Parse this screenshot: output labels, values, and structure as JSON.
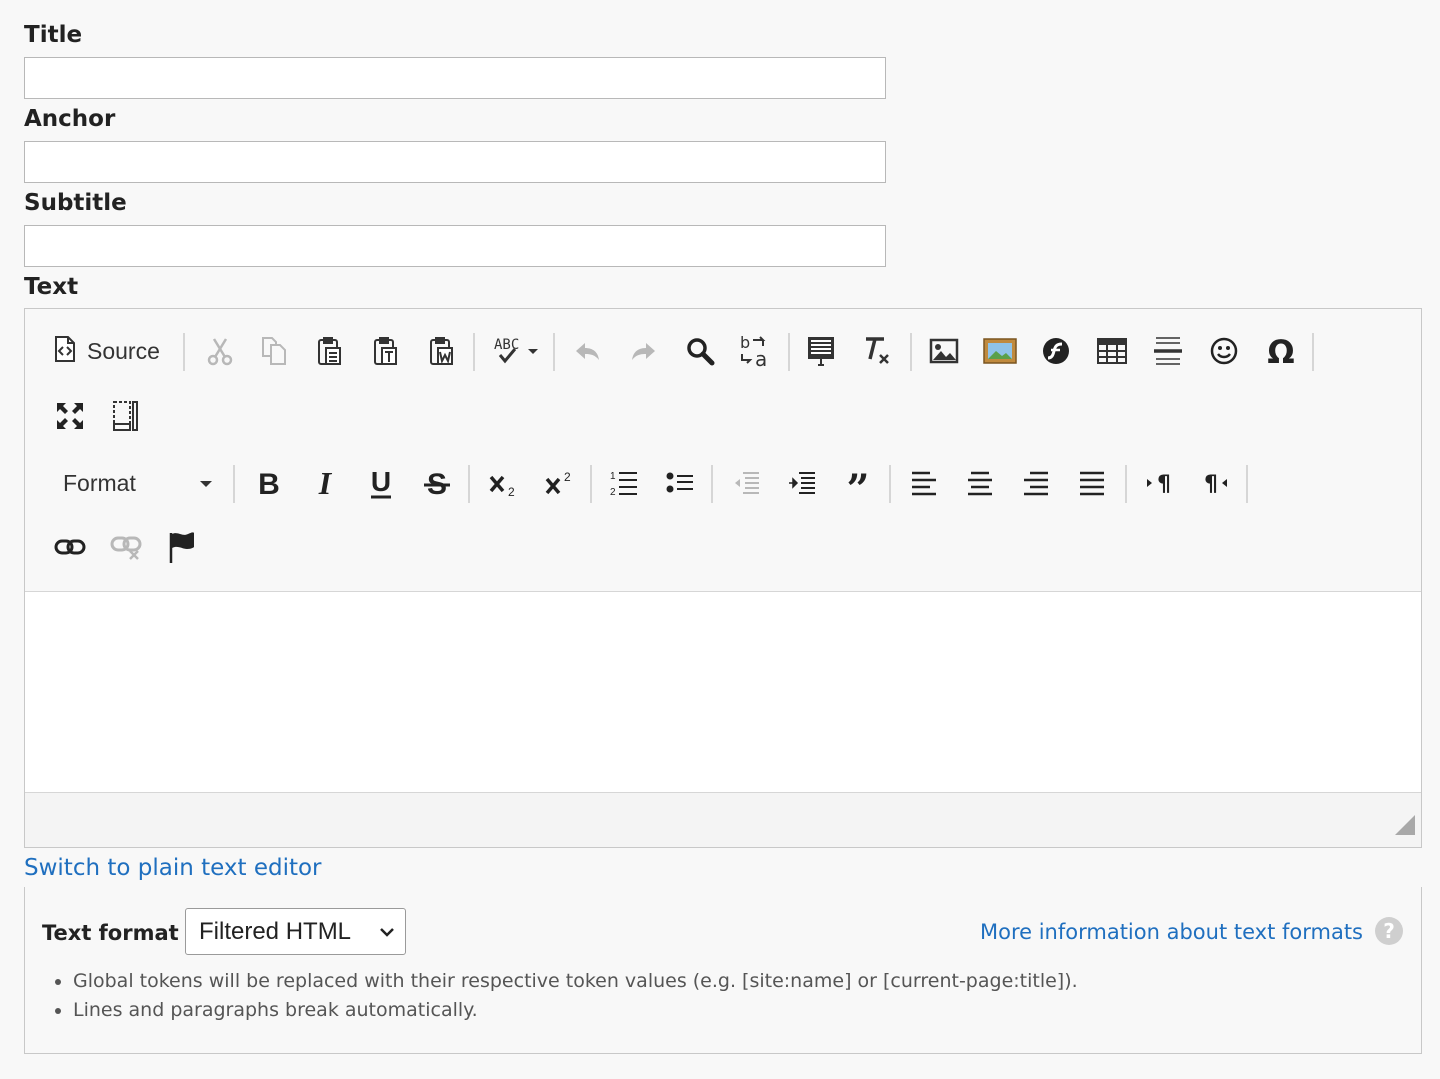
{
  "form": {
    "title_label": "Title",
    "title_value": "",
    "anchor_label": "Anchor",
    "anchor_value": "",
    "subtitle_label": "Subtitle",
    "subtitle_value": "",
    "text_label": "Text"
  },
  "editor": {
    "source_label": "Source",
    "format_label": "Format",
    "content": ""
  },
  "switch_link": "Switch to plain text editor",
  "text_format": {
    "label": "Text format",
    "selected": "Filtered HTML",
    "more_info_link": "More information about text formats",
    "help_glyph": "?",
    "tips": [
      "Global tokens will be replaced with their respective token values (e.g. [site:name] or [current-page:title]).",
      "Lines and paragraphs break automatically."
    ]
  },
  "icons": {
    "toolbar_row1": [
      "source-icon",
      "cut-icon",
      "copy-icon",
      "paste-icon",
      "paste-text-icon",
      "paste-word-icon",
      "spellcheck-icon",
      "undo-icon",
      "redo-icon",
      "find-icon",
      "replace-icon",
      "select-all-icon",
      "remove-format-icon",
      "image-icon",
      "image-alt-icon",
      "flash-icon",
      "table-icon",
      "horizontal-rule-icon",
      "smiley-icon",
      "special-char-icon"
    ],
    "toolbar_row2": [
      "maximize-icon",
      "show-blocks-icon"
    ],
    "toolbar_row3": [
      "bold-icon",
      "italic-icon",
      "underline-icon",
      "strike-icon",
      "subscript-icon",
      "superscript-icon",
      "numbered-list-icon",
      "bulleted-list-icon",
      "outdent-icon",
      "indent-icon",
      "blockquote-icon",
      "align-left-icon",
      "align-center-icon",
      "align-right-icon",
      "justify-icon",
      "ltr-icon",
      "rtl-icon"
    ],
    "toolbar_row4": [
      "link-icon",
      "unlink-icon",
      "anchor-flag-icon"
    ]
  },
  "colors": {
    "link": "#1f6fbf",
    "disabled_icon": "#b8b8b8",
    "icon": "#333333"
  }
}
